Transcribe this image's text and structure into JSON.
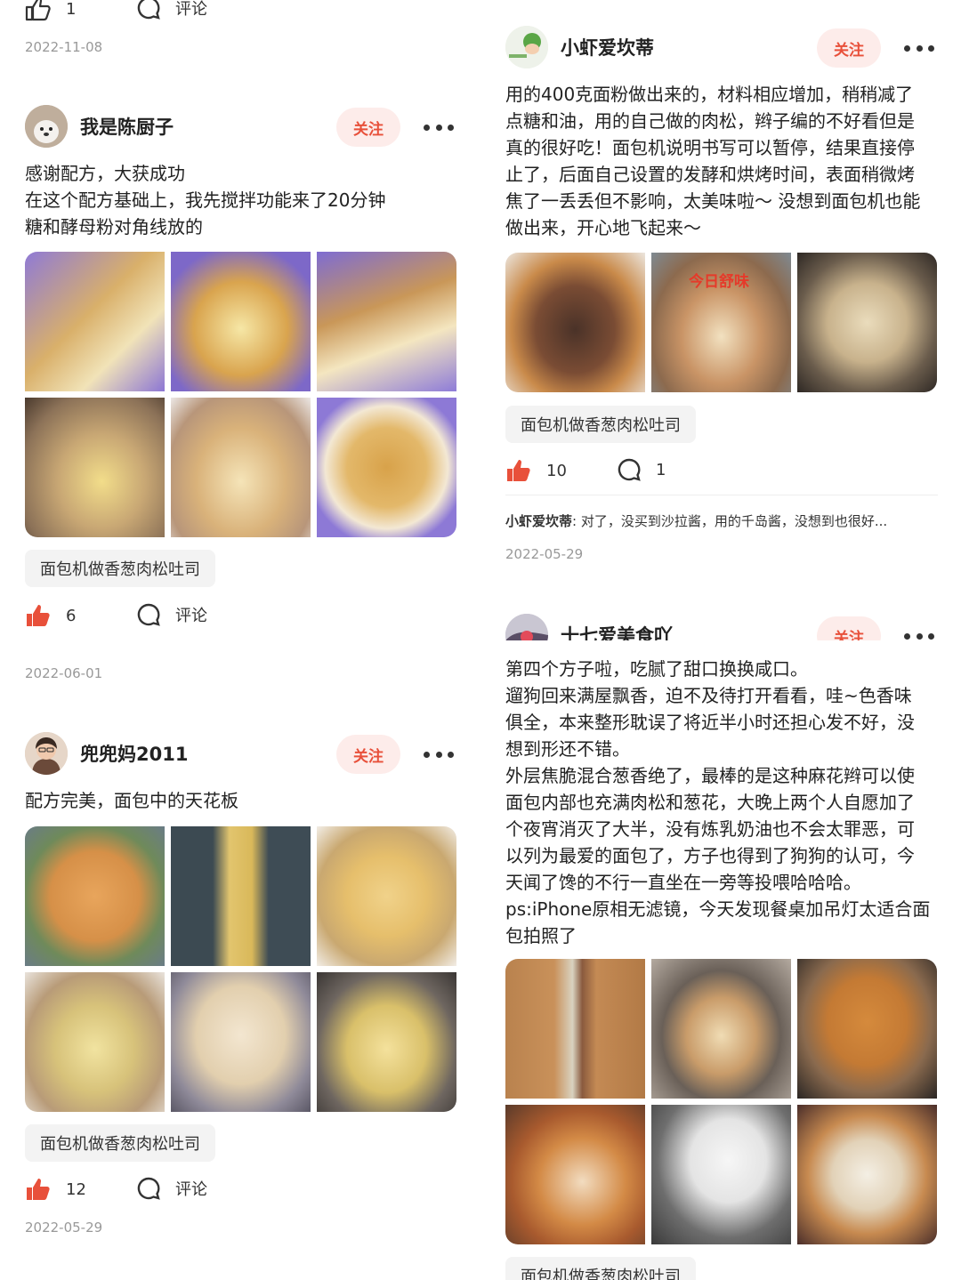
{
  "left": {
    "top_partial": {
      "likes": "1",
      "comment_label": "评论",
      "date": "2022-11-08"
    },
    "post1": {
      "author": "我是陈厨子",
      "follow": "关注",
      "text": "感谢配方，大获成功\n在这个配方基础上，我先搅拌功能来了20分钟\n糖和酵母粉对角线放的",
      "tag": "面包机做香葱肉松吐司",
      "likes": "6",
      "comment_label": "评论",
      "date": "2022-06-01"
    },
    "post2": {
      "author": "兜兜妈2011",
      "follow": "关注",
      "text": "配方完美，面包中的天花板",
      "tag": "面包机做香葱肉松吐司",
      "likes": "12",
      "comment_label": "评论",
      "date": "2022-05-29"
    }
  },
  "right": {
    "post1": {
      "author": "小虾爱坎蒂",
      "follow": "关注",
      "text": "用的400克面粉做出来的，材料相应增加，稍稍减了\n点糖和油，用的自己做的肉松，辫子编的不好看但是\n真的很好吃！面包机说明书写可以暂停，结果直接停\n止了，后面自己设置的发酵和烘烤时间，表面稍微烤\n焦了一丢丢但不影响，太美味啦～ 没想到面包机也能\n做出来，开心地飞起来～",
      "photo_text_1": "今日舒味",
      "tag": "面包机做香葱肉松吐司",
      "likes": "10",
      "comments": "1",
      "comment_author": "小虾爱坎蒂",
      "comment_text": "对了，没买到沙拉酱，用的千岛酱，没想到也很好...",
      "date": "2022-05-29"
    },
    "post2": {
      "author": "十七爱美食吖",
      "follow": "关注",
      "text": "第四个方子啦，吃腻了甜口换换咸口。\n遛狗回来满屋飘香，迫不及待打开看看，哇~色香味\n俱全，本来整形耽误了将近半小时还担心发不好，没\n想到形还不错。\n外层焦脆混合葱香绝了，最棒的是这种麻花辫可以使\n面包内部也充满肉松和葱花，大晚上两个人自愿加了\n个夜宵消灭了大半，没有炼乳奶油也不会太罪恶，可\n以列为最爱的面包了，方子也得到了狗狗的认可，今\n天闻了馋的不行一直坐在一旁等投喂哈哈哈。\nps:iPhone原相无滤镜，今天发现餐桌加吊灯太适合面\n包拍照了",
      "tag": "面包机做香葱肉松吐司"
    }
  },
  "colors": {
    "accent": "#e8503a",
    "follow_bg": "#fdecea",
    "tag_bg": "#f3f3f3",
    "date": "#999999"
  },
  "icons": {
    "like": "thumbs-up-icon",
    "comment": "comment-bubble-icon",
    "more": "more-dots-icon"
  }
}
